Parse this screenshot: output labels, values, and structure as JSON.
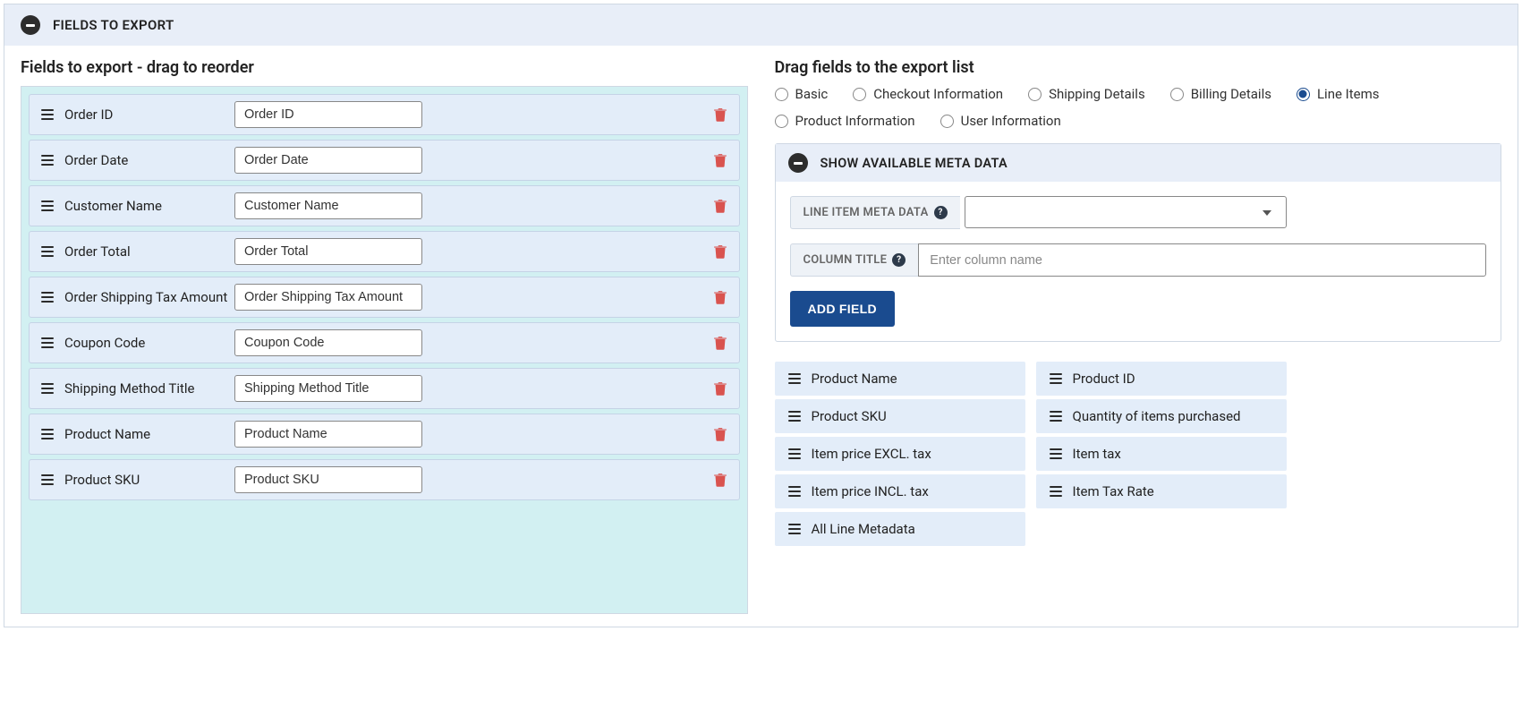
{
  "panel": {
    "title": "FIELDS TO EXPORT"
  },
  "left": {
    "heading": "Fields to export - drag to reorder",
    "fields": [
      {
        "label": "Order ID",
        "value": "Order ID"
      },
      {
        "label": "Order Date",
        "value": "Order Date"
      },
      {
        "label": "Customer Name",
        "value": "Customer Name"
      },
      {
        "label": "Order Total",
        "value": "Order Total"
      },
      {
        "label": "Order Shipping Tax Amount",
        "value": "Order Shipping Tax Amount"
      },
      {
        "label": "Coupon Code",
        "value": "Coupon Code"
      },
      {
        "label": "Shipping Method Title",
        "value": "Shipping Method Title"
      },
      {
        "label": "Product Name",
        "value": "Product Name"
      },
      {
        "label": "Product SKU",
        "value": "Product SKU"
      }
    ]
  },
  "right": {
    "heading": "Drag fields to the export list",
    "categories": [
      {
        "label": "Basic",
        "selected": false
      },
      {
        "label": "Checkout Information",
        "selected": false
      },
      {
        "label": "Shipping Details",
        "selected": false
      },
      {
        "label": "Billing Details",
        "selected": false
      },
      {
        "label": "Line Items",
        "selected": true
      },
      {
        "label": "Product Information",
        "selected": false
      },
      {
        "label": "User Information",
        "selected": false
      }
    ],
    "meta": {
      "title": "SHOW AVAILABLE META DATA",
      "row1_label": "LINE ITEM META DATA",
      "row2_label": "COLUMN TITLE",
      "column_placeholder": "Enter column name",
      "add_btn": "ADD FIELD",
      "help_glyph": "?"
    },
    "available": {
      "col1": [
        "Product Name",
        "Product SKU",
        "Item price EXCL. tax",
        "Item price INCL. tax",
        "All Line Metadata"
      ],
      "col2": [
        "Product ID",
        "Quantity of items purchased",
        "Item tax",
        "Item Tax Rate"
      ]
    }
  }
}
